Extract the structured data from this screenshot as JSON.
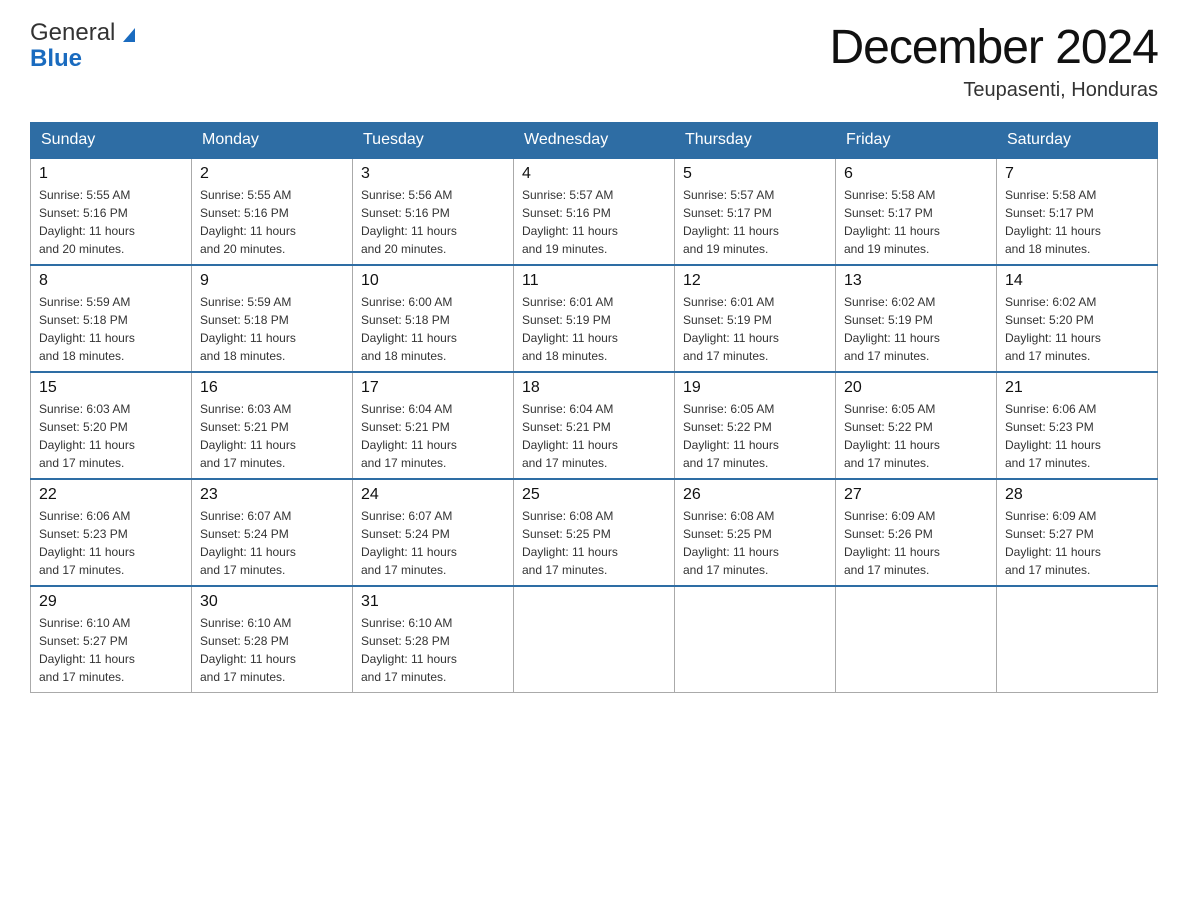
{
  "header": {
    "logo_line1": "General",
    "logo_line2": "Blue",
    "title": "December 2024",
    "subtitle": "Teupasenti, Honduras"
  },
  "days_of_week": [
    "Sunday",
    "Monday",
    "Tuesday",
    "Wednesday",
    "Thursday",
    "Friday",
    "Saturday"
  ],
  "weeks": [
    [
      {
        "day": "1",
        "sunrise": "5:55 AM",
        "sunset": "5:16 PM",
        "daylight": "11 hours and 20 minutes."
      },
      {
        "day": "2",
        "sunrise": "5:55 AM",
        "sunset": "5:16 PM",
        "daylight": "11 hours and 20 minutes."
      },
      {
        "day": "3",
        "sunrise": "5:56 AM",
        "sunset": "5:16 PM",
        "daylight": "11 hours and 20 minutes."
      },
      {
        "day": "4",
        "sunrise": "5:57 AM",
        "sunset": "5:16 PM",
        "daylight": "11 hours and 19 minutes."
      },
      {
        "day": "5",
        "sunrise": "5:57 AM",
        "sunset": "5:17 PM",
        "daylight": "11 hours and 19 minutes."
      },
      {
        "day": "6",
        "sunrise": "5:58 AM",
        "sunset": "5:17 PM",
        "daylight": "11 hours and 19 minutes."
      },
      {
        "day": "7",
        "sunrise": "5:58 AM",
        "sunset": "5:17 PM",
        "daylight": "11 hours and 18 minutes."
      }
    ],
    [
      {
        "day": "8",
        "sunrise": "5:59 AM",
        "sunset": "5:18 PM",
        "daylight": "11 hours and 18 minutes."
      },
      {
        "day": "9",
        "sunrise": "5:59 AM",
        "sunset": "5:18 PM",
        "daylight": "11 hours and 18 minutes."
      },
      {
        "day": "10",
        "sunrise": "6:00 AM",
        "sunset": "5:18 PM",
        "daylight": "11 hours and 18 minutes."
      },
      {
        "day": "11",
        "sunrise": "6:01 AM",
        "sunset": "5:19 PM",
        "daylight": "11 hours and 18 minutes."
      },
      {
        "day": "12",
        "sunrise": "6:01 AM",
        "sunset": "5:19 PM",
        "daylight": "11 hours and 17 minutes."
      },
      {
        "day": "13",
        "sunrise": "6:02 AM",
        "sunset": "5:19 PM",
        "daylight": "11 hours and 17 minutes."
      },
      {
        "day": "14",
        "sunrise": "6:02 AM",
        "sunset": "5:20 PM",
        "daylight": "11 hours and 17 minutes."
      }
    ],
    [
      {
        "day": "15",
        "sunrise": "6:03 AM",
        "sunset": "5:20 PM",
        "daylight": "11 hours and 17 minutes."
      },
      {
        "day": "16",
        "sunrise": "6:03 AM",
        "sunset": "5:21 PM",
        "daylight": "11 hours and 17 minutes."
      },
      {
        "day": "17",
        "sunrise": "6:04 AM",
        "sunset": "5:21 PM",
        "daylight": "11 hours and 17 minutes."
      },
      {
        "day": "18",
        "sunrise": "6:04 AM",
        "sunset": "5:21 PM",
        "daylight": "11 hours and 17 minutes."
      },
      {
        "day": "19",
        "sunrise": "6:05 AM",
        "sunset": "5:22 PM",
        "daylight": "11 hours and 17 minutes."
      },
      {
        "day": "20",
        "sunrise": "6:05 AM",
        "sunset": "5:22 PM",
        "daylight": "11 hours and 17 minutes."
      },
      {
        "day": "21",
        "sunrise": "6:06 AM",
        "sunset": "5:23 PM",
        "daylight": "11 hours and 17 minutes."
      }
    ],
    [
      {
        "day": "22",
        "sunrise": "6:06 AM",
        "sunset": "5:23 PM",
        "daylight": "11 hours and 17 minutes."
      },
      {
        "day": "23",
        "sunrise": "6:07 AM",
        "sunset": "5:24 PM",
        "daylight": "11 hours and 17 minutes."
      },
      {
        "day": "24",
        "sunrise": "6:07 AM",
        "sunset": "5:24 PM",
        "daylight": "11 hours and 17 minutes."
      },
      {
        "day": "25",
        "sunrise": "6:08 AM",
        "sunset": "5:25 PM",
        "daylight": "11 hours and 17 minutes."
      },
      {
        "day": "26",
        "sunrise": "6:08 AM",
        "sunset": "5:25 PM",
        "daylight": "11 hours and 17 minutes."
      },
      {
        "day": "27",
        "sunrise": "6:09 AM",
        "sunset": "5:26 PM",
        "daylight": "11 hours and 17 minutes."
      },
      {
        "day": "28",
        "sunrise": "6:09 AM",
        "sunset": "5:27 PM",
        "daylight": "11 hours and 17 minutes."
      }
    ],
    [
      {
        "day": "29",
        "sunrise": "6:10 AM",
        "sunset": "5:27 PM",
        "daylight": "11 hours and 17 minutes."
      },
      {
        "day": "30",
        "sunrise": "6:10 AM",
        "sunset": "5:28 PM",
        "daylight": "11 hours and 17 minutes."
      },
      {
        "day": "31",
        "sunrise": "6:10 AM",
        "sunset": "5:28 PM",
        "daylight": "11 hours and 17 minutes."
      },
      null,
      null,
      null,
      null
    ]
  ],
  "labels": {
    "sunrise": "Sunrise:",
    "sunset": "Sunset:",
    "daylight": "Daylight:"
  },
  "colors": {
    "header_bg": "#2e6da4",
    "header_text": "#ffffff",
    "border": "#aaa",
    "text": "#333",
    "title": "#111"
  }
}
